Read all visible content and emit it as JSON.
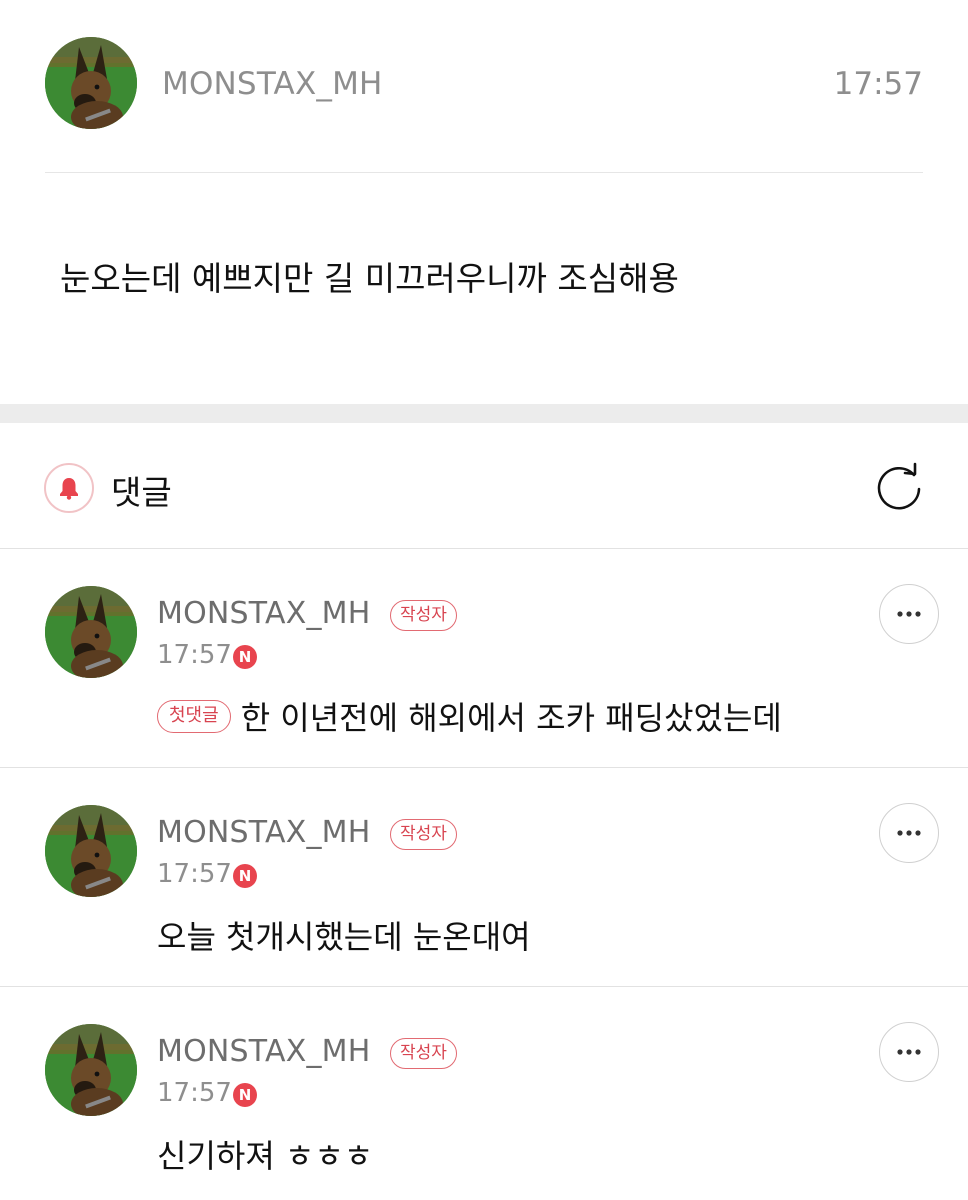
{
  "post": {
    "author": "MONSTAX_MH",
    "time": "17:57",
    "body": "눈오는데 예쁘지만 길 미끄러우니까 조심해용"
  },
  "comments_header": {
    "title": "댓글",
    "bell_icon": "bell-icon",
    "refresh_icon": "refresh-icon"
  },
  "comments": [
    {
      "author": "MONSTAX_MH",
      "writer_badge": "작성자",
      "time": "17:57",
      "new_badge": "N",
      "first_badge": "첫댓글",
      "text": "한 이년전에 해외에서 조카 패딩샀었는데"
    },
    {
      "author": "MONSTAX_MH",
      "writer_badge": "작성자",
      "time": "17:57",
      "new_badge": "N",
      "text": "오늘 첫개시했는데 눈온대여"
    },
    {
      "author": "MONSTAX_MH",
      "writer_badge": "작성자",
      "time": "17:57",
      "new_badge": "N",
      "text": "신기하져 ㅎㅎㅎ"
    }
  ],
  "colors": {
    "accent": "#e8444e",
    "badge_border": "#e26a72",
    "muted_text": "#8e8e8e"
  }
}
